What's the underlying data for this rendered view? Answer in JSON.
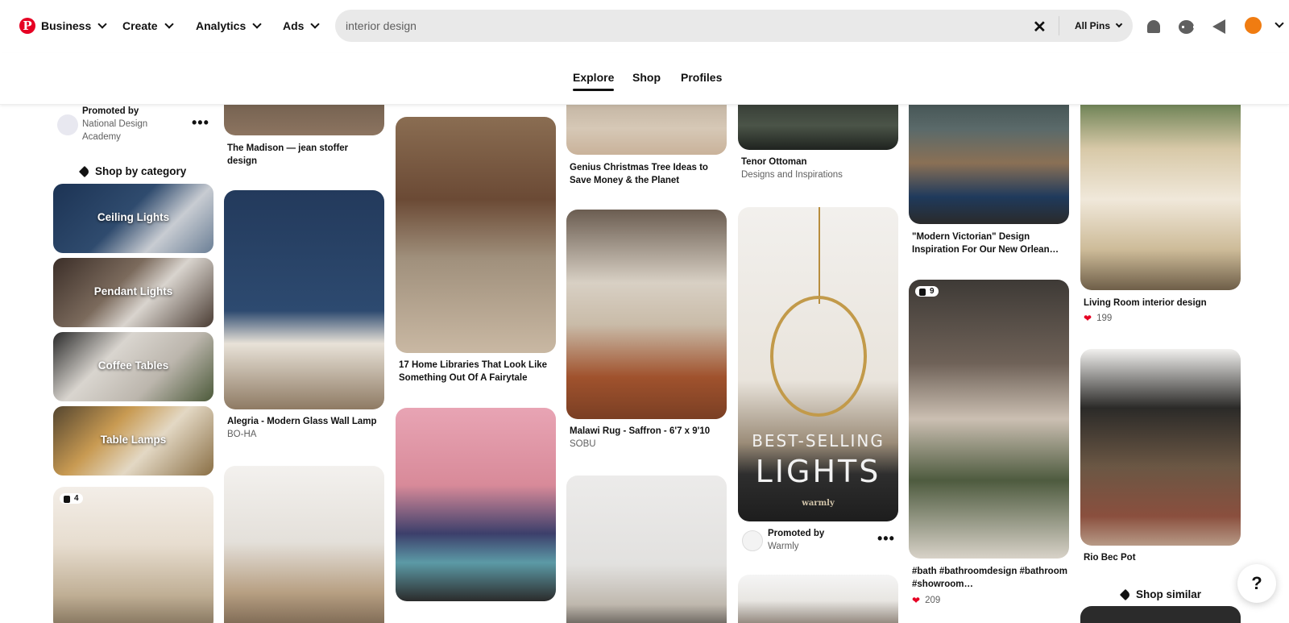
{
  "header": {
    "logo": "P",
    "nav": [
      {
        "label": "Business"
      },
      {
        "label": "Create"
      },
      {
        "label": "Analytics"
      },
      {
        "label": "Ads"
      }
    ],
    "search_query": "interior design",
    "search_scope": "All Pins"
  },
  "tabs": [
    {
      "label": "Explore",
      "active": true
    },
    {
      "label": "Shop",
      "active": false
    },
    {
      "label": "Profiles",
      "active": false
    }
  ],
  "col1": {
    "promoted_label": "Promoted by",
    "promoted_name": "National Design Academy",
    "shop_by_category": "Shop by category",
    "categories": [
      {
        "label": "Ceiling Lights"
      },
      {
        "label": "Pendant Lights"
      },
      {
        "label": "Coffee Tables"
      },
      {
        "label": "Table Lamps"
      }
    ],
    "board_badge": "4"
  },
  "col2": {
    "pin1_title": "The Madison — jean stoffer design",
    "pin2_title": "Alegria - Modern Glass Wall Lamp",
    "pin2_source": "BO-HA"
  },
  "col3": {
    "pin1_title": "17 Home Libraries That Look Like Something Out Of A Fairytale"
  },
  "col4": {
    "pin1_title": "Genius Christmas Tree Ideas to Save Money & the Planet",
    "pin2_title": "Malawi Rug - Saffron - 6'7 x 9'10",
    "pin2_source": "SOBU"
  },
  "col5": {
    "pin1_title": "Tenor Ottoman",
    "pin1_source": "Designs and Inspirations",
    "ad_text_1": "BEST-SELLING",
    "ad_text_2": "LIGHTS",
    "ad_brand": "warmly",
    "promoted_label": "Promoted by",
    "promoted_name": "Warmly"
  },
  "col6": {
    "pin1_title": "\"Modern Victorian\" Design Inspiration For Our New Orlean…",
    "board_badge": "9",
    "pin2_title": "#bath #bathroomdesign #bathroom #showroom…",
    "pin2_likes": "209"
  },
  "col7": {
    "pin1_title": "Living Room interior design",
    "pin1_likes": "199",
    "pin2_title": "Rio Bec Pot",
    "shop_similar": "Shop similar"
  },
  "help": "?",
  "colors": {
    "brand": "#e60023",
    "search_bg": "#e9e9e9",
    "avatar": "#f07c11"
  }
}
